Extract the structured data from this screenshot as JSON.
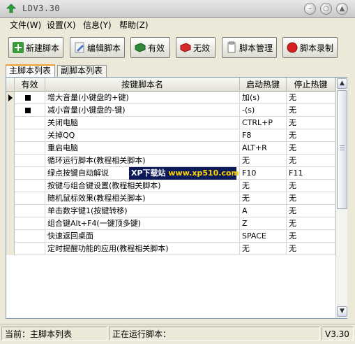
{
  "window": {
    "title": "LDV3.30"
  },
  "menu": [
    {
      "label": "文件(W)"
    },
    {
      "label": "设置(X)"
    },
    {
      "label": "信息(Y)"
    },
    {
      "label": "帮助(Z)"
    }
  ],
  "toolbar": [
    {
      "label": "新建脚本",
      "icon": "add-icon"
    },
    {
      "label": "编辑脚本",
      "icon": "edit-icon"
    },
    {
      "label": "有效",
      "icon": "enable-icon"
    },
    {
      "label": "无效",
      "icon": "disable-icon"
    },
    {
      "label": "脚本管理",
      "icon": "manage-icon"
    },
    {
      "label": "脚本录制",
      "icon": "record-icon"
    }
  ],
  "tabs": [
    {
      "label": "主脚本列表",
      "active": true
    },
    {
      "label": "副脚本列表",
      "active": false
    }
  ],
  "table": {
    "columns": [
      "有效",
      "按键脚本名",
      "启动热键",
      "停止热键"
    ],
    "rows": [
      {
        "enabled": true,
        "name": "增大音量(小键盘的+键)",
        "start": "加(s)",
        "stop": "无",
        "current": true
      },
      {
        "enabled": true,
        "name": "减小音量(小键盘的-键)",
        "start": "-(s)",
        "stop": "无"
      },
      {
        "enabled": false,
        "name": "关闭电脑",
        "start": "CTRL+P",
        "stop": "无"
      },
      {
        "enabled": false,
        "name": "关掉QQ",
        "start": "F8",
        "stop": "无"
      },
      {
        "enabled": false,
        "name": "重启电脑",
        "start": "ALT+R",
        "stop": "无"
      },
      {
        "enabled": false,
        "name": "循环运行脚本(教程相关脚本)",
        "start": "无",
        "stop": "无"
      },
      {
        "enabled": false,
        "name": "绿点按键自动解说",
        "start": "F10",
        "stop": "F11"
      },
      {
        "enabled": false,
        "name": "按键与组合键设置(教程相关脚本)",
        "start": "无",
        "stop": "无"
      },
      {
        "enabled": false,
        "name": "随机鼠标效果(教程相关脚本)",
        "start": "无",
        "stop": "无"
      },
      {
        "enabled": false,
        "name": "单击数字键1(按键转移)",
        "start": "A",
        "stop": "无"
      },
      {
        "enabled": false,
        "name": "组合键Alt+F4(一键顶多键)",
        "start": "Z",
        "stop": "无"
      },
      {
        "enabled": false,
        "name": "快速返回桌面",
        "start": "SPACE",
        "stop": "无"
      },
      {
        "enabled": false,
        "name": "定时提醒功能的应用(教程相关脚本)",
        "start": "无",
        "stop": "无"
      }
    ]
  },
  "watermark": {
    "prefix": "XP下载站",
    "url": "www.xp510.com"
  },
  "status": {
    "current": "当前：主脚本列表",
    "running": "正在运行脚本：",
    "version": "V3.30"
  }
}
